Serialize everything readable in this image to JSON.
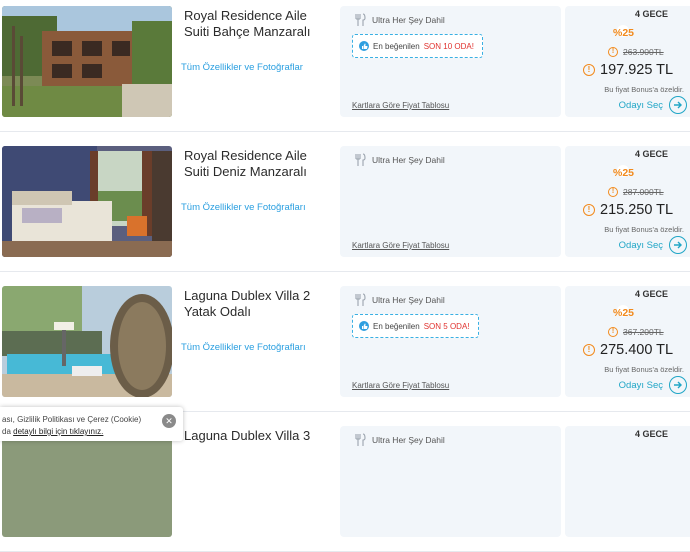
{
  "rooms": [
    {
      "title": "Royal Residence Aile Suiti Bahçe Manzaralı",
      "features_link": "Tüm Özellikler ve Fotoğraflar",
      "board_icon": "utensils-icon",
      "board": "Ultra Her Şey Dahil",
      "badge": {
        "text": "En beğenilen",
        "alert": "SON 10 ODA!"
      },
      "table_link": "Kartlara Göre Fiyat Tablosu",
      "nights": "4 GECE",
      "discount": "%25",
      "old_price": "263.900TL",
      "new_price": "197.925 TL",
      "bonus_note": "Bu fiyat Bonus'a özeldir.",
      "select_label": "Odayı Seç"
    },
    {
      "title": "Royal Residence Aile Suiti Deniz Manzaralı",
      "features_link": "Tüm Özellikler ve Fotoğrafları",
      "board": "Ultra Her Şey Dahil",
      "table_link": "Kartlara Göre Fiyat Tablosu",
      "nights": "4 GECE",
      "discount": "%25",
      "old_price": "287.000TL",
      "new_price": "215.250 TL",
      "bonus_note": "Bu fiyat Bonus'a özeldir.",
      "select_label": "Odayı Seç"
    },
    {
      "title": "Laguna Dublex Villa 2 Yatak Odalı",
      "features_link": "Tüm Özellikler ve Fotoğrafları",
      "board": "Ultra Her Şey Dahil",
      "badge": {
        "text": "En beğenilen",
        "alert": "SON 5 ODA!"
      },
      "table_link": "Kartlara Göre Fiyat Tablosu",
      "nights": "4 GECE",
      "discount": "%25",
      "old_price": "367.200TL",
      "new_price": "275.400 TL",
      "bonus_note": "Bu fiyat Bonus'a özeldir.",
      "select_label": "Odayı Seç"
    },
    {
      "title": "Laguna Dublex Villa 3",
      "board": "Ultra Her Şey Dahil",
      "nights": "4 GECE"
    }
  ],
  "icons": {
    "info": "info-icon",
    "thumb": "thumbs-up-icon",
    "arrow": "arrow-right-icon",
    "close": "close-icon"
  },
  "colors": {
    "link": "#2a9fe0",
    "discount": "#f28a1c",
    "alert": "#e0322f",
    "select": "#20a6c6",
    "panel": "#f2f6fa"
  },
  "cookie": {
    "line1": "ası, Gizlilik Politikası ve Çerez (Cookie)",
    "line2_prefix": "da ",
    "link": "detaylı bilgi için tıklayınız."
  },
  "info_glyph": "!",
  "arrow_glyph": "→",
  "close_glyph": "✕"
}
